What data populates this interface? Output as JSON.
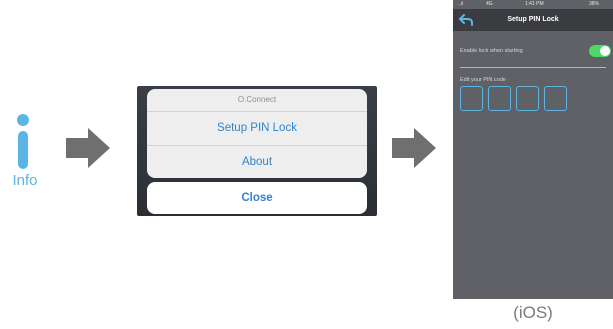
{
  "info": {
    "label": "Info",
    "color": "#5bb5e3"
  },
  "action_sheet": {
    "title": "O.Connect",
    "items": [
      "Setup PIN Lock",
      "About"
    ],
    "close_label": "Close"
  },
  "phone": {
    "status": {
      "signal": "..ıl",
      "network": "4G",
      "time": "1:41 PM",
      "battery": "38%"
    },
    "nav_title": "Setup PIN Lock",
    "enable_lock_label": "Enable lock when starting",
    "enable_lock_on": true,
    "pin_label": "Edit your PIN code",
    "pin_digits": [
      "",
      "",
      "",
      ""
    ]
  },
  "caption": "(iOS)"
}
